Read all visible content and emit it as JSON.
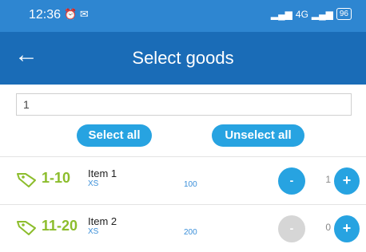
{
  "status_bar": {
    "time": "12:36",
    "alarm_icon": "alarm-icon",
    "mail_icon": "mail-icon",
    "network": "4G",
    "battery": "96"
  },
  "app_bar": {
    "back_icon": "back-arrow-icon",
    "title": "Select goods"
  },
  "search": {
    "value": "1"
  },
  "buttons": {
    "select_all": "Select all",
    "unselect_all": "Unselect all"
  },
  "items": [
    {
      "range": "1-10",
      "name": "Item 1",
      "size": "XS",
      "number": "100",
      "minus": "-",
      "qty": "1",
      "plus": "+",
      "minus_active": true
    },
    {
      "range": "11-20",
      "name": "Item 2",
      "size": "XS",
      "number": "200",
      "minus": "-",
      "qty": "0",
      "plus": "+",
      "minus_active": false
    }
  ],
  "colors": {
    "status_bar": "#2e86d1",
    "app_bar": "#1a6cb7",
    "accent": "#27a3e1",
    "range_green": "#8cbd2c"
  }
}
